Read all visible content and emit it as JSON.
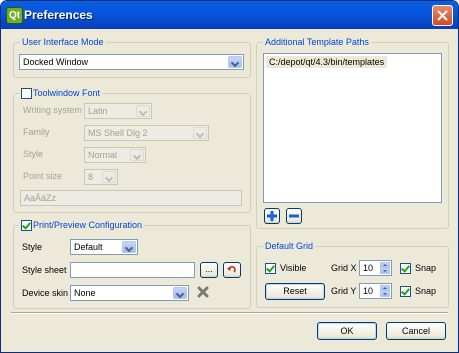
{
  "window": {
    "title": "Preferences",
    "icon_glyph": "Qt"
  },
  "ui_mode": {
    "title": "User Interface Mode",
    "selected": "Docked Window"
  },
  "toolwindow_font": {
    "title": "Toolwindow Font",
    "checked": false,
    "writing_system_label": "Writing system",
    "writing_system_value": "Latin",
    "family_label": "Family",
    "family_value": "MS Shell Dlg 2",
    "style_label": "Style",
    "style_value": "Normal",
    "point_size_label": "Point size",
    "point_size_value": "8",
    "sample_text": "AaÄáZz"
  },
  "print_preview": {
    "title": "Print/Preview Configuration",
    "checked": true,
    "style_label": "Style",
    "style_value": "Default",
    "stylesheet_label": "Style sheet",
    "stylesheet_value": "",
    "browse_label": "...",
    "device_skin_label": "Device skin",
    "device_skin_value": "None"
  },
  "template_paths": {
    "title": "Additional Template Paths",
    "paths": [
      "C:/depot/qt/4.3/bin/templates"
    ]
  },
  "default_grid": {
    "title": "Default Grid",
    "visible_label": "Visible",
    "visible_checked": true,
    "reset_label": "Reset",
    "grid_x_label": "Grid X",
    "grid_x_value": "10",
    "grid_y_label": "Grid Y",
    "grid_y_value": "10",
    "snap_label": "Snap",
    "snap_x_checked": true,
    "snap_y_checked": true
  },
  "buttons": {
    "ok": "OK",
    "cancel": "Cancel"
  },
  "colors": {
    "title_bar": "#0757de",
    "group_title": "#0046d5",
    "dialog_bg": "#ece9d8"
  },
  "icons": {
    "add": "plus-icon",
    "remove": "minus-icon",
    "reset_stylesheet": "undo-arrow-icon",
    "clear_skin": "delete-x-icon",
    "close": "close-icon"
  }
}
